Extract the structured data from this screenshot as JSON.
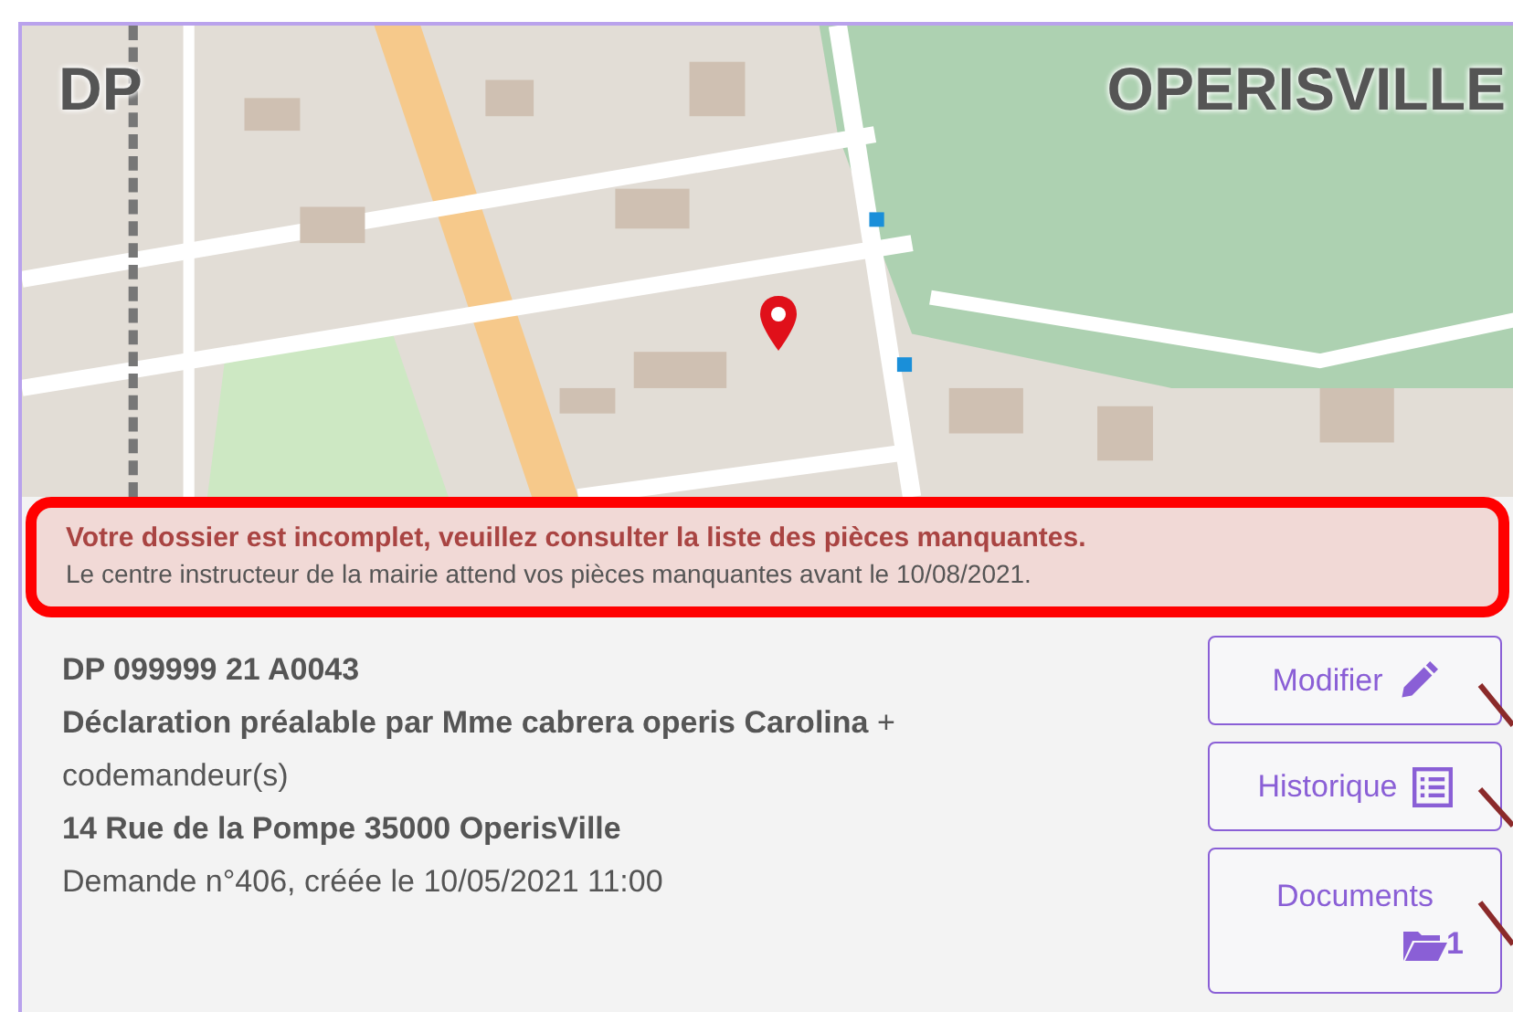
{
  "map": {
    "label_left": "DP",
    "label_right": "OPERISVILLE"
  },
  "alert": {
    "title": "Votre dossier est incomplet, veuillez consulter la liste des pièces manquantes.",
    "message": "Le centre instructeur de la mairie attend vos pièces manquantes avant le 10/08/2021.",
    "highlighted": true
  },
  "details": [
    {
      "text": "DP 099999 21 A0043",
      "bold": true
    },
    {
      "text": "**Déclaration préalable par Mme cabrera operis Carolina** + codemandeur(s)",
      "bold": false
    },
    {
      "text": "14 Rue de la Pompe 35000 OperisVille",
      "bold": true
    },
    {
      "text": "Demande n°406, créée le 10/05/2021 11:00",
      "bold": false
    }
  ],
  "buttons": [
    {
      "label": "Modifier",
      "kind": "edit"
    },
    {
      "label": "Historique",
      "kind": "history"
    },
    {
      "label": "Documents",
      "kind": "documents",
      "count": "1"
    }
  ]
}
